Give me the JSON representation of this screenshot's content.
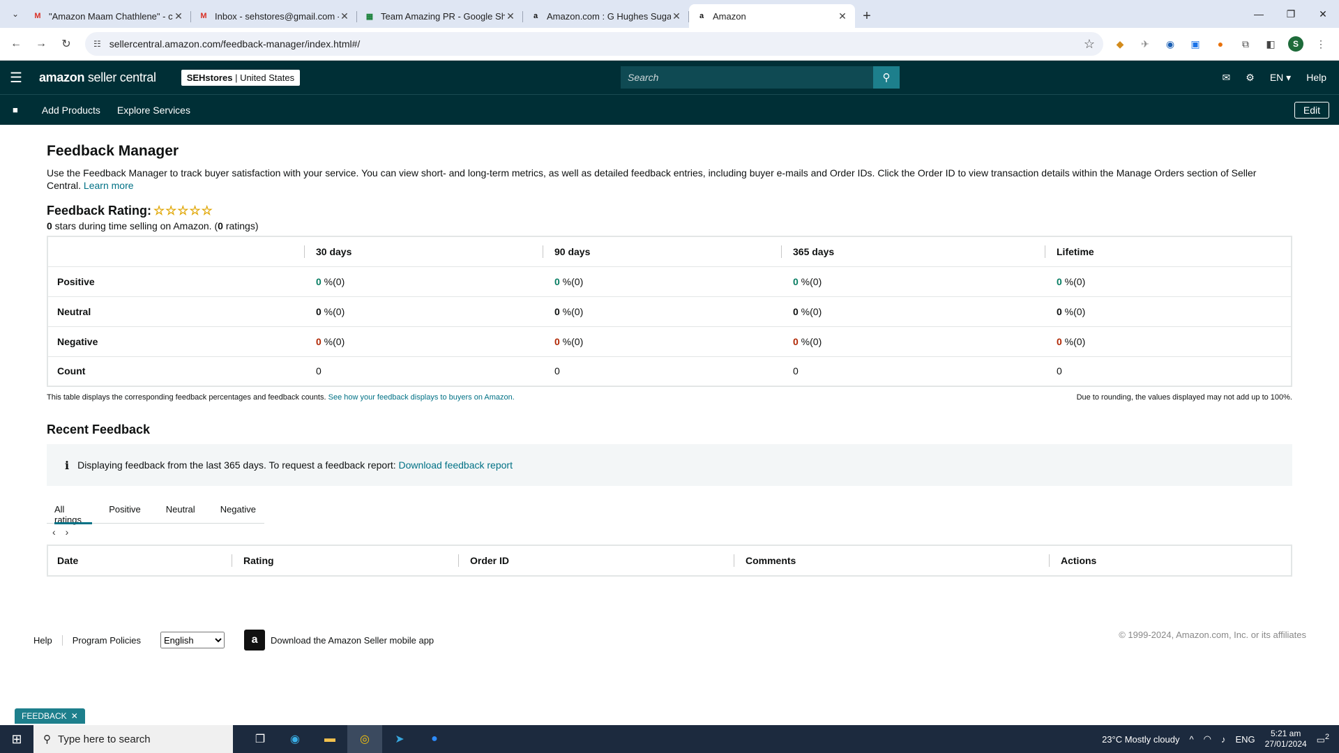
{
  "browser": {
    "tabs": [
      {
        "favicon": "M",
        "favicon_color": "#d93025",
        "title": "\"Amazon Maam Chathlene\" - c"
      },
      {
        "favicon": "M",
        "favicon_color": "#d93025",
        "title": "Inbox - sehstores@gmail.com -"
      },
      {
        "favicon": "▦",
        "favicon_color": "#188038",
        "title": "Team Amazing PR - Google She"
      },
      {
        "favicon": "a",
        "favicon_color": "#111111",
        "title": "Amazon.com : G Hughes Sugar"
      },
      {
        "favicon": "a",
        "favicon_color": "#111111",
        "title": "Amazon"
      }
    ],
    "url": "sellercentral.amazon.com/feedback-manager/index.html#/",
    "profile_initial": "S"
  },
  "header": {
    "logo_bold": "amazon",
    "logo_light": " seller central",
    "store_name": "SEHstores",
    "store_region": "United States",
    "search_placeholder": "Search",
    "language": "EN ▾",
    "help": "Help",
    "nav_add_products": "Add Products",
    "nav_explore_services": "Explore Services",
    "edit": "Edit"
  },
  "page": {
    "title": "Feedback Manager",
    "description": "Use the Feedback Manager to track buyer satisfaction with your service. You can view short- and long-term metrics, as well as detailed feedback entries, including buyer e-mails and Order IDs. Click the Order ID to view transaction details within the Manage Orders section of Seller Central.",
    "learn_more": "Learn more",
    "rating_title": "Feedback Rating:",
    "stars": "☆☆☆☆☆",
    "stars_count": "0",
    "rating_sub_mid": " stars during time selling on Amazon. (",
    "ratings_count": "0",
    "rating_sub_end": " ratings)"
  },
  "metrics": {
    "columns": [
      "30 days",
      "90 days",
      "365 days",
      "Lifetime"
    ],
    "rows": [
      {
        "label": "Positive",
        "cells": [
          "0",
          "0",
          "0",
          "0"
        ],
        "suffix": " %(0)"
      },
      {
        "label": "Neutral",
        "cells": [
          "0",
          "0",
          "0",
          "0"
        ],
        "suffix": " %(0)"
      },
      {
        "label": "Negative",
        "cells": [
          "0",
          "0",
          "0",
          "0"
        ],
        "suffix": " %(0)"
      },
      {
        "label": "Count",
        "cells": [
          "0",
          "0",
          "0",
          "0"
        ],
        "suffix": ""
      }
    ],
    "note_left": "This table displays the corresponding feedback percentages and feedback counts.",
    "note_left_link": "See how your feedback displays to buyers on Amazon.",
    "note_right": "Due to rounding, the values displayed may not add up to 100%."
  },
  "recent": {
    "title": "Recent Feedback",
    "info_icon": "i",
    "info_text": "Displaying feedback from the last 365 days. To request a feedback report:",
    "info_link": "Download feedback report",
    "tabs": [
      "All ratings",
      "Positive",
      "Neutral",
      "Negative"
    ],
    "columns": [
      "Date",
      "Rating",
      "Order ID",
      "Comments",
      "Actions"
    ]
  },
  "footer": {
    "help": "Help",
    "policies": "Program Policies",
    "language_selected": "English",
    "download_app": "Download the Amazon Seller mobile app",
    "copyright": "© 1999-2024, Amazon.com, Inc. or its affiliates",
    "feedback_badge": "FEEDBACK"
  },
  "taskbar": {
    "search_placeholder": "Type here to search",
    "weather": "23°C  Mostly cloudy",
    "lang": "ENG",
    "time": "5:21 am",
    "date": "27/01/2024",
    "notif_count": "2"
  }
}
